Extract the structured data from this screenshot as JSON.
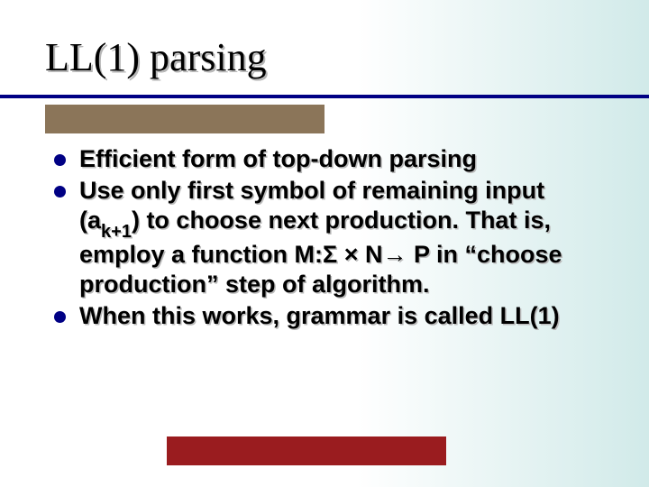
{
  "title": "LL(1) parsing",
  "bullets": {
    "b1": "Efficient form of top-down parsing",
    "b2_pre": "Use only first symbol of remaining input (a",
    "b2_sub": "k+1",
    "b2_mid": ") to choose next production.  That is, employ a function M:",
    "b2_sigma": "Σ",
    "b2_times": " × N",
    "b2_arrow": "→",
    "b2_post": " P in “choose production” step of algorithm.",
    "b3": "When this works, grammar is called LL(1)"
  }
}
